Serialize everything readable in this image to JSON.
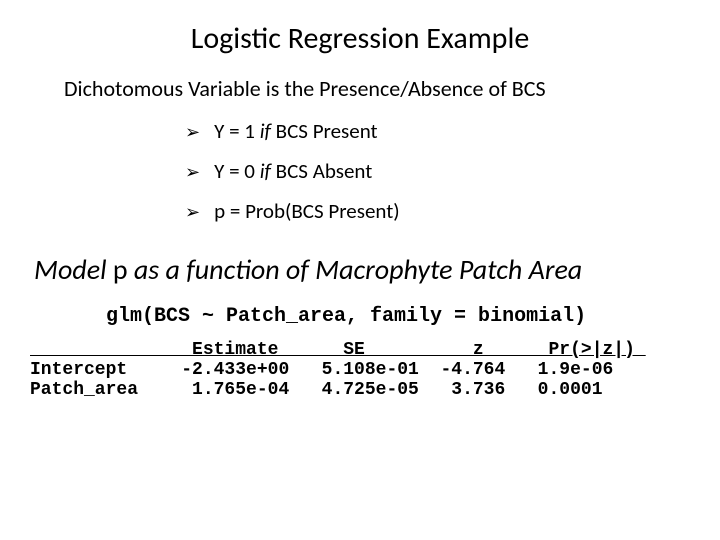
{
  "title": "Logistic Regression Example",
  "subhead": "Dichotomous Variable is the Presence/Absence of BCS",
  "bullets": [
    {
      "prefix": "Y = 1  ",
      "italic": "if ",
      "suffix": "BCS Present"
    },
    {
      "prefix": "Y = 0  ",
      "italic": "if ",
      "suffix": "BCS Absent"
    },
    {
      "prefix": "p = Prob(BCS Present)",
      "italic": "",
      "suffix": ""
    }
  ],
  "model_line": {
    "lead": "Model ",
    "p": "p",
    "tail": " as a function of Macrophyte Patch Area"
  },
  "code_call": "glm(BCS ~ Patch_area, family = binomial)",
  "chart_data": {
    "type": "table",
    "title": "Logistic regression coefficients",
    "columns": [
      "",
      "Estimate",
      "SE",
      "z",
      "Pr(>|z|)"
    ],
    "rows": [
      {
        "name": "Intercept",
        "Estimate": "-2.433e+00",
        "SE": "5.108e-01",
        "z": "-4.764",
        "Pr": "1.9e-06"
      },
      {
        "name": "Patch_area",
        "Estimate": " 1.765e-04",
        "SE": "4.725e-05",
        "z": " 3.736",
        "Pr": "0.0001"
      }
    ]
  },
  "table_render": {
    "header": "               Estimate      SE          z      Pr(>|z|) ",
    "row0": "Intercept     -2.433e+00   5.108e-01  -4.764   1.9e-06",
    "row1": "Patch_area     1.765e-04   4.725e-05   3.736   0.0001"
  }
}
